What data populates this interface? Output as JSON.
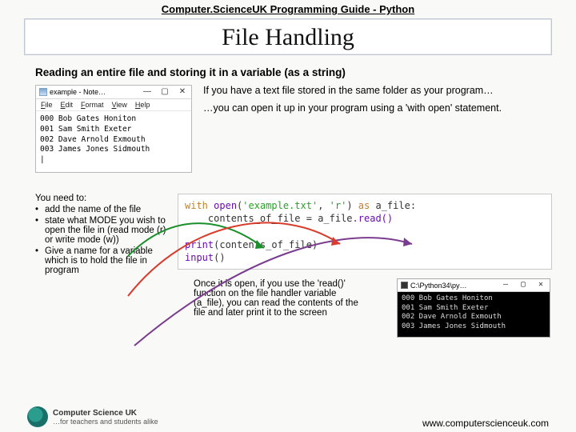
{
  "header": "Computer.ScienceUK Programming Guide - Python",
  "title": "File Handling",
  "section_heading": "Reading an entire file and storing it in a variable (as a string)",
  "upper_text": {
    "line1": "If you have a text file stored in the same folder as your program…",
    "line2": "…you can open it up in your program using a 'with open' statement."
  },
  "notepad": {
    "title": "example - Note…",
    "btn_min": "—",
    "btn_max": "▢",
    "btn_close": "✕",
    "menu": {
      "file": "File",
      "edit": "Edit",
      "format": "Format",
      "view": "View",
      "help": "Help"
    },
    "body": "000 Bob Gates Honiton\n001 Sam Smith Exeter\n002 Dave Arnold Exmouth\n003 James Jones Sidmouth\n|"
  },
  "needto": {
    "header": "You need to:",
    "items": [
      "add the name of the file",
      "state what MODE you wish to open the file in (read mode (r) or write mode (w))",
      "Give a name for a variable which is to hold the file in program"
    ]
  },
  "code_box": {
    "tokens": {
      "with": "with",
      "open": "open",
      "lp": "(",
      "rp": ")",
      "str_file": "'example.txt'",
      "comma": ", ",
      "str_mode": "'r'",
      "as": " as ",
      "afile": "a_file",
      "colon": ":",
      "indent": "    ",
      "cof": "contents_of_file",
      "eq": " = ",
      "read": ".read()",
      "blank": "",
      "print": "print",
      "input": "input"
    }
  },
  "explain": "Once it is open, if you use the 'read()' function on the file handler variable (a_file), you can read the contents of the file and later print it to the screen",
  "output": {
    "title": "C:\\Python34\\py…",
    "btn_min": "—",
    "btn_max": "▢",
    "btn_close": "✕",
    "body": "000 Bob Gates Honiton\n001 Sam Smith Exeter\n002 Dave Arnold Exmouth\n003 James Jones Sidmouth"
  },
  "logo": {
    "brand": "Computer Science UK",
    "tag": "…for teachers and students alike"
  },
  "footer_url": "www.computerscienceuk.com"
}
